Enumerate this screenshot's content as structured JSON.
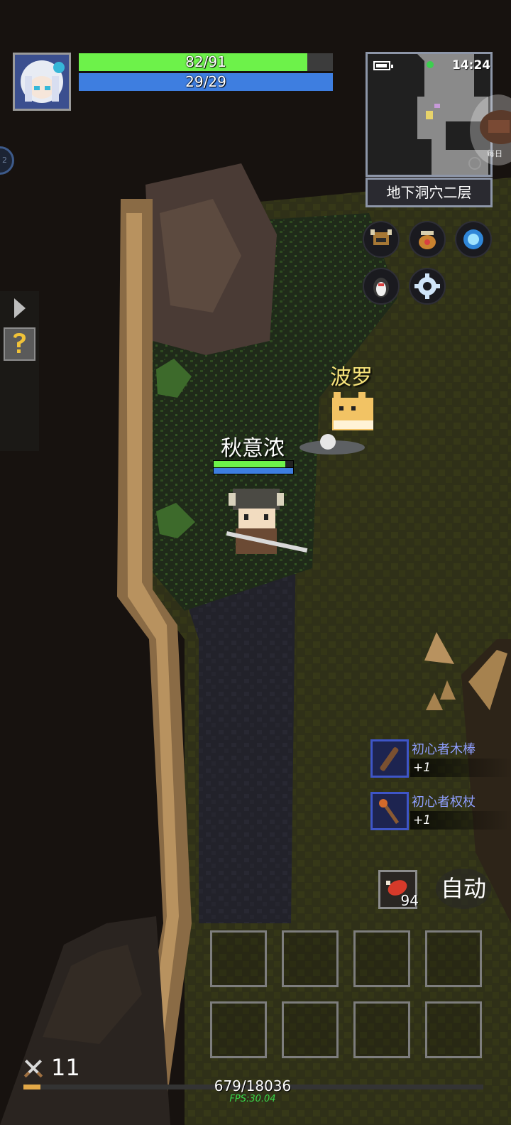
{
  "player": {
    "hp_text": "82/91",
    "hp_ratio": 0.9,
    "mp_text": "29/29",
    "mp_ratio": 1.0,
    "name": "秋意浓",
    "overhead_hp_ratio": 0.9,
    "overhead_mp_ratio": 1.0
  },
  "minimap": {
    "time": "14:24",
    "area_name": "地下洞穴二层"
  },
  "pet": {
    "name": "波罗"
  },
  "menu_icons": [
    {
      "name": "helmet-icon"
    },
    {
      "name": "bag-icon"
    },
    {
      "name": "crystal-icon"
    },
    {
      "name": "penguin-icon"
    },
    {
      "name": "gear-icon"
    }
  ],
  "loot": [
    {
      "name": "初心者木棒",
      "count": "+1",
      "icon": "wooden-club-icon"
    },
    {
      "name": "初心者权杖",
      "count": "+1",
      "icon": "scepter-icon"
    }
  ],
  "food": {
    "icon": "meat-icon",
    "count": "94"
  },
  "auto_label": "自动",
  "skill_slots": 8,
  "level": "11",
  "exp_text": "679/18036",
  "exp_ratio": 0.0376,
  "fps_text": "FPS:30.04",
  "colors": {
    "hp": "#6df24a",
    "mp": "#3e7ee0",
    "pet_name": "#f6e27a",
    "loot_name": "#8f9fff",
    "fps": "#38d64a"
  }
}
